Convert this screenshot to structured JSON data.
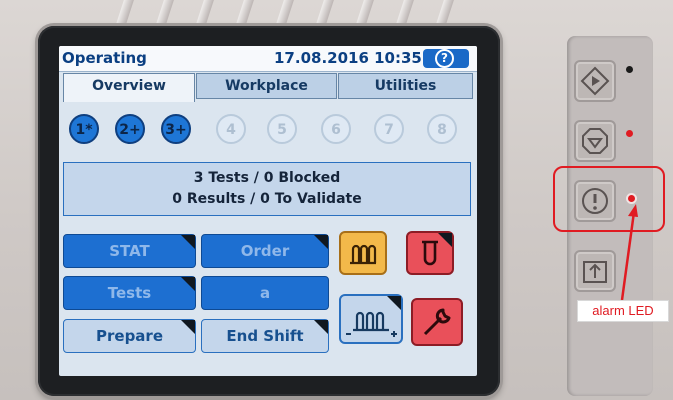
{
  "screen": {
    "title": "Operating",
    "datetime": "17.08.2016 10:35",
    "help_label": "?"
  },
  "tabs": [
    {
      "label": "Overview",
      "active": true
    },
    {
      "label": "Workplace",
      "active": false
    },
    {
      "label": "Utilities",
      "active": false
    }
  ],
  "steps": [
    {
      "label": "1*",
      "active": true
    },
    {
      "label": "2+",
      "active": true
    },
    {
      "label": "3+",
      "active": true
    },
    {
      "label": "4",
      "active": false
    },
    {
      "label": "5",
      "active": false
    },
    {
      "label": "6",
      "active": false
    },
    {
      "label": "7",
      "active": false
    },
    {
      "label": "8",
      "active": false
    }
  ],
  "status": {
    "line1": "3 Tests / 0 Blocked",
    "line2": "0 Results / 0 To Validate"
  },
  "buttons": {
    "stat": "STAT",
    "order": "Order",
    "tests": "Tests",
    "a": "a",
    "prepare": "Prepare",
    "end_shift": "End Shift"
  },
  "icon_buttons": [
    {
      "name": "rack-icon",
      "color": "#f3b94a"
    },
    {
      "name": "tube-icon",
      "color": "#e9505a"
    },
    {
      "name": "rack-load-icon",
      "color": "#c4d6eb"
    },
    {
      "name": "wrench-icon",
      "color": "#e9505a"
    }
  ],
  "hardware_buttons": [
    "start-icon",
    "stop-icon",
    "alarm-icon",
    "eject-icon"
  ],
  "leds": {
    "start": "#1a1a1a",
    "stop": "#e01b22",
    "alarm": "#e01b22"
  },
  "annotation": {
    "label": "alarm LED",
    "color": "#e01b22"
  }
}
